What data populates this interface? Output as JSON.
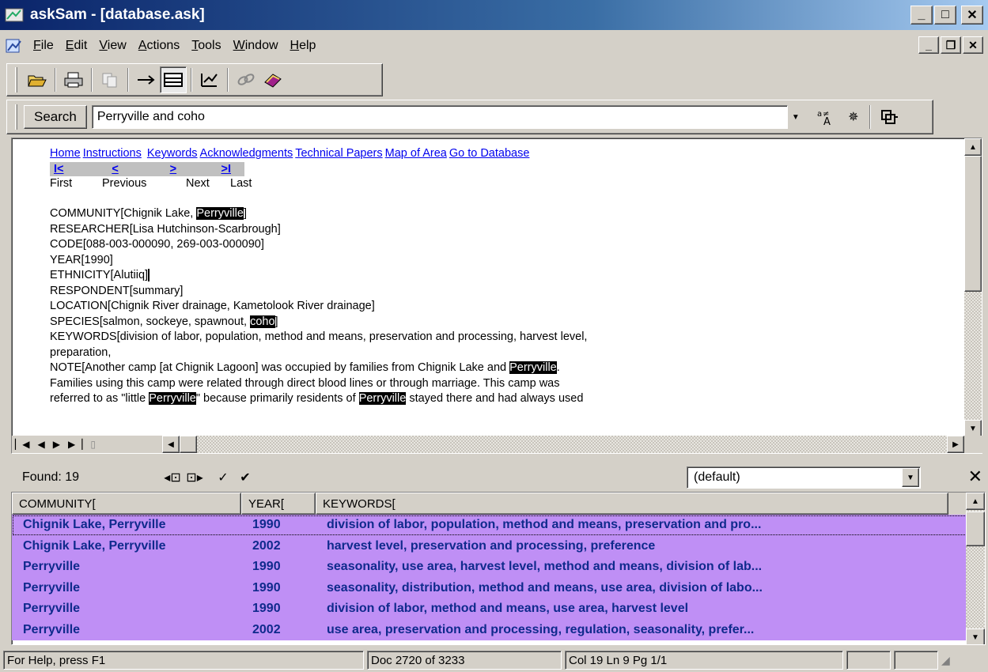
{
  "window": {
    "title": "askSam - [database.ask]"
  },
  "menu": [
    {
      "pre": "",
      "u": "F",
      "post": "ile"
    },
    {
      "pre": "",
      "u": "E",
      "post": "dit"
    },
    {
      "pre": "",
      "u": "V",
      "post": "iew"
    },
    {
      "pre": "",
      "u": "A",
      "post": "ctions"
    },
    {
      "pre": "",
      "u": "T",
      "post": "ools"
    },
    {
      "pre": "",
      "u": "W",
      "post": "indow"
    },
    {
      "pre": "",
      "u": "H",
      "post": "elp"
    }
  ],
  "search": {
    "button": "Search",
    "query": "Perryville and coho"
  },
  "doc": {
    "links": [
      "Home",
      "Instructions",
      "Keywords",
      "Acknowledgments",
      "Technical Papers",
      "Map of Area",
      "Go to Database"
    ],
    "nav_arrows": [
      "I<",
      "<",
      ">",
      ">I"
    ],
    "nav_labels": [
      "First",
      "Previous",
      "Next",
      "Last"
    ],
    "community_pre": "COMMUNITY[Chignik Lake, ",
    "community_hl": "Perryville",
    "community_post": "]",
    "researcher": "RESEARCHER[Lisa Hutchinson-Scarbrough]",
    "code": "CODE[088-003-000090, 269-003-000090]",
    "year": "YEAR[1990]",
    "ethnicity": "ETHNICITY[Alutiiq]",
    "respondent": "RESPONDENT[summary]",
    "location": "LOCATION[Chignik River drainage, Kametolook River drainage]",
    "species_pre": "SPECIES[salmon, sockeye, spawnout, ",
    "species_hl": "coho",
    "species_post": "]",
    "keywords_1": "KEYWORDS[division of labor, population, method and means, preservation and processing, harvest level,",
    "keywords_2": "preparation,",
    "note_pre": "NOTE[Another camp [at Chignik Lagoon] was occupied by families from Chignik Lake and ",
    "note_hl": "Perryville",
    "note_post": ".",
    "note_2": "Families using this camp were related through direct blood lines or through marriage.  This camp was",
    "note_3a": "referred to as \"little ",
    "note_3hl": "Perryville",
    "note_3b": "\" because primarily residents of ",
    "note_3hl2": "Perryville",
    "note_3c": " stayed there and had always used"
  },
  "results": {
    "found": "Found: 19",
    "view": "(default)",
    "columns": [
      "COMMUNITY[",
      "YEAR[",
      "KEYWORDS["
    ],
    "rows": [
      [
        "Chignik Lake, Perryville",
        "1990",
        "division of labor, population, method and means, preservation and pro..."
      ],
      [
        "Chignik Lake, Perryville",
        "2002",
        "harvest level, preservation and processing, preference"
      ],
      [
        "Perryville",
        "1990",
        "seasonality, use area, harvest level, method and means, division of lab..."
      ],
      [
        "Perryville",
        "1990",
        "seasonality, distribution, method and means, use area, division of labo..."
      ],
      [
        "Perryville",
        "1990",
        "division of labor, method and means, use area, harvest level"
      ],
      [
        "Perryville",
        "2002",
        "use area, preservation and processing, regulation, seasonality, prefer..."
      ]
    ]
  },
  "status": {
    "help": "For Help, press F1",
    "doc": "Doc 2720 of 3233",
    "pos": "Col 19  Ln 9  Pg 1/1"
  },
  "colors": {
    "title_start": "#0a246a",
    "row_bg": "#bf8ff5",
    "row_text": "#0f2a8c",
    "link": "#0000ee"
  }
}
